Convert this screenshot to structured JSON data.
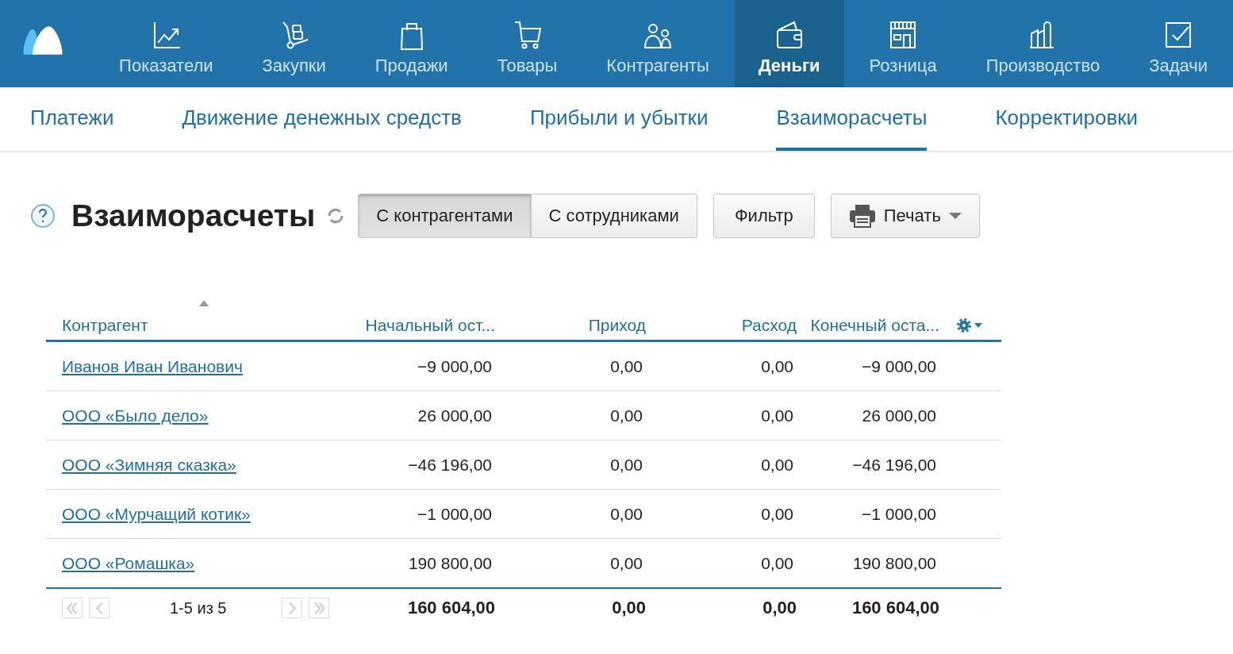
{
  "nav": {
    "items": [
      {
        "label": "Показатели",
        "selected": false
      },
      {
        "label": "Закупки",
        "selected": false
      },
      {
        "label": "Продажи",
        "selected": false
      },
      {
        "label": "Товары",
        "selected": false
      },
      {
        "label": "Контрагенты",
        "selected": false
      },
      {
        "label": "Деньги",
        "selected": true
      },
      {
        "label": "Розница",
        "selected": false
      },
      {
        "label": "Производство",
        "selected": false
      },
      {
        "label": "Задачи",
        "selected": false
      }
    ]
  },
  "subtabs": [
    {
      "label": "Платежи",
      "selected": false
    },
    {
      "label": "Движение денежных средств",
      "selected": false
    },
    {
      "label": "Прибыли и убытки",
      "selected": false
    },
    {
      "label": "Взаиморасчеты",
      "selected": true
    },
    {
      "label": "Корректировки",
      "selected": false
    }
  ],
  "page": {
    "title": "Взаиморасчеты",
    "toggle": [
      {
        "label": "С контрагентами",
        "selected": true
      },
      {
        "label": "С сотрудниками",
        "selected": false
      }
    ],
    "filter_button": "Фильтр",
    "print_button": "Печать"
  },
  "table": {
    "columns": [
      "Контрагент",
      "Начальный ост...",
      "Приход",
      "Расход",
      "Конечный оста..."
    ],
    "rows": [
      [
        "Иванов Иван Иванович",
        "−9 000,00",
        "0,00",
        "0,00",
        "−9 000,00"
      ],
      [
        "ООО «Было дело»",
        "26 000,00",
        "0,00",
        "0,00",
        "26 000,00"
      ],
      [
        "ООО «Зимняя сказка»",
        "−46 196,00",
        "0,00",
        "0,00",
        "−46 196,00"
      ],
      [
        "ООО «Мурчащий котик»",
        "−1 000,00",
        "0,00",
        "0,00",
        "−1 000,00"
      ],
      [
        "ООО «Ромашка»",
        "190 800,00",
        "0,00",
        "0,00",
        "190 800,00"
      ]
    ],
    "totals": [
      "160 604,00",
      "0,00",
      "0,00",
      "160 604,00"
    ],
    "pagination": {
      "summary": "1-5 из 5",
      "buttons": [
        {
          "kind": "first",
          "disabled": true
        },
        {
          "kind": "prev",
          "disabled": true
        },
        {
          "kind": "next",
          "disabled": true
        },
        {
          "kind": "last",
          "disabled": true
        }
      ]
    }
  }
}
